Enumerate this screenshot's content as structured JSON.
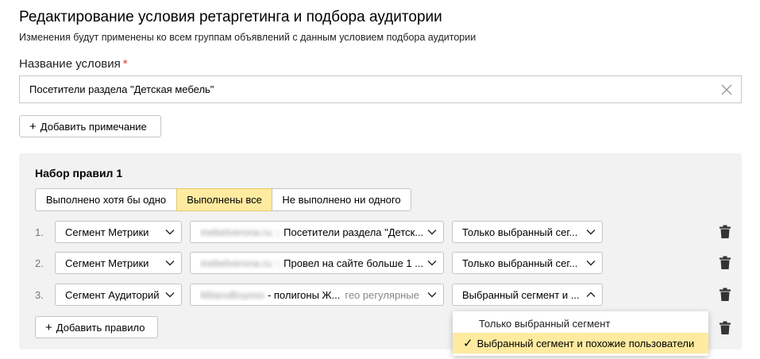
{
  "header": {
    "title": "Редактирование условия ретаргетинга и подбора аудитории",
    "subtitle": "Изменения будут применены ко всем группам объявлений с данным условием подбора аудитории"
  },
  "name_field": {
    "label": "Название условия",
    "required_mark": "*",
    "value": "Посетители раздела \"Детская мебель\""
  },
  "add_note_label": "Добавить примечание",
  "rule_set": {
    "title": "Набор правил 1",
    "modes": [
      "Выполнено хотя бы одно",
      "Выполнены все",
      "Не выполнено ни одного"
    ],
    "selected_mode": "Выполнены все",
    "rules": [
      {
        "num": "1.",
        "type": "Сегмент Метрики",
        "source": "mebelverona.ru ::",
        "segment": "Посетители раздела \"Детск...",
        "extra": "",
        "scope": "Только выбранный сег..."
      },
      {
        "num": "2.",
        "type": "Сегмент Метрики",
        "source": "mebelverona.ru ::",
        "segment": "Провел на сайте больше 1 ...",
        "extra": "",
        "scope": "Только выбранный сег..."
      },
      {
        "num": "3.",
        "type": "Сегмент Аудиторий",
        "source": "MilanoBoyoss",
        "segment": "- полигоны Ж...",
        "extra": "гео регулярные",
        "scope": "Выбранный сегмент и ..."
      }
    ],
    "add_rule_label": "Добавить правило"
  },
  "dropdown": {
    "options": [
      "Только выбранный сегмент",
      "Выбранный сегмент и похожие пользователи"
    ],
    "selected": "Выбранный сегмент и похожие пользователи",
    "check_glyph": "✓"
  },
  "icons": {
    "clear": "close-icon",
    "plus": "plus-icon",
    "chevron": "chevron-down-icon",
    "trash": "trash-icon"
  },
  "colors": {
    "accent_yellow": "#ffeba0",
    "required_red": "#e53d2e",
    "panel_gray": "#f2f2f2"
  }
}
